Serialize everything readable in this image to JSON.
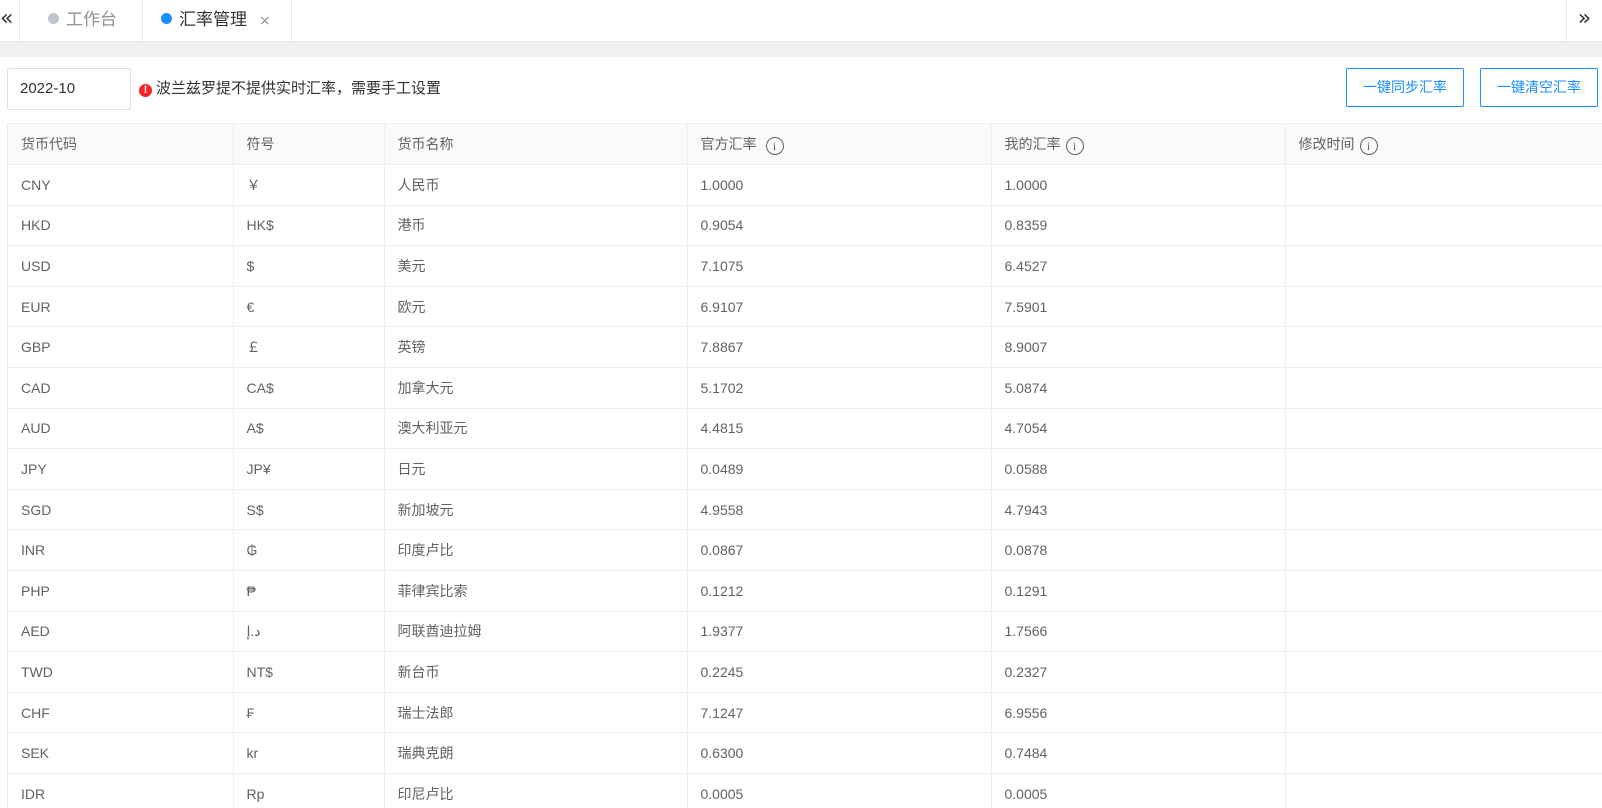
{
  "tabs": {
    "collapse_left_icon": "«",
    "expand_right_icon": "»",
    "items": [
      {
        "label": "工作台",
        "active": false
      },
      {
        "label": "汇率管理",
        "active": true,
        "close": "×"
      }
    ]
  },
  "toolbar": {
    "month": "2022-10",
    "notice_icon": "!",
    "notice": "波兰兹罗提不提供实时汇率，需要手工设置",
    "sync_button": "一键同步汇率",
    "clear_button": "一键清空汇率"
  },
  "colors": {
    "accent": "#1890ff",
    "warning": "#f5222d",
    "inactive_dot": "#c0c4cc"
  },
  "table": {
    "columns": [
      "货币代码",
      "符号",
      "货币名称",
      "官方汇率",
      "我的汇率",
      "修改时间"
    ],
    "info_icon": "i",
    "rows": [
      {
        "code": "CNY",
        "symbol": "￥",
        "name": "人民币",
        "official": "1.0000",
        "mine": "1.0000",
        "modified": ""
      },
      {
        "code": "HKD",
        "symbol": "HK$",
        "name": "港币",
        "official": "0.9054",
        "mine": "0.8359",
        "modified": ""
      },
      {
        "code": "USD",
        "symbol": "$",
        "name": "美元",
        "official": "7.1075",
        "mine": "6.4527",
        "modified": ""
      },
      {
        "code": "EUR",
        "symbol": "€",
        "name": "欧元",
        "official": "6.9107",
        "mine": "7.5901",
        "modified": ""
      },
      {
        "code": "GBP",
        "symbol": "￡",
        "name": "英镑",
        "official": "7.8867",
        "mine": "8.9007",
        "modified": ""
      },
      {
        "code": "CAD",
        "symbol": "CA$",
        "name": "加拿大元",
        "official": "5.1702",
        "mine": "5.0874",
        "modified": ""
      },
      {
        "code": "AUD",
        "symbol": "A$",
        "name": "澳大利亚元",
        "official": "4.4815",
        "mine": "4.7054",
        "modified": ""
      },
      {
        "code": "JPY",
        "symbol": "JP¥",
        "name": "日元",
        "official": "0.0489",
        "mine": "0.0588",
        "modified": ""
      },
      {
        "code": "SGD",
        "symbol": "S$",
        "name": "新加坡元",
        "official": "4.9558",
        "mine": "4.7943",
        "modified": ""
      },
      {
        "code": "INR",
        "symbol": "₲",
        "name": "印度卢比",
        "official": "0.0867",
        "mine": "0.0878",
        "modified": ""
      },
      {
        "code": "PHP",
        "symbol": "₱",
        "name": "菲律宾比索",
        "official": "0.1212",
        "mine": "0.1291",
        "modified": ""
      },
      {
        "code": "AED",
        "symbol": "د.إ",
        "name": "阿联酋迪拉姆",
        "official": "1.9377",
        "mine": "1.7566",
        "modified": ""
      },
      {
        "code": "TWD",
        "symbol": "NT$",
        "name": "新台币",
        "official": "0.2245",
        "mine": "0.2327",
        "modified": ""
      },
      {
        "code": "CHF",
        "symbol": "₣",
        "name": "瑞士法郎",
        "official": "7.1247",
        "mine": "6.9556",
        "modified": ""
      },
      {
        "code": "SEK",
        "symbol": "kr",
        "name": "瑞典克朗",
        "official": "0.6300",
        "mine": "0.7484",
        "modified": ""
      },
      {
        "code": "IDR",
        "symbol": "Rp",
        "name": "印尼卢比",
        "official": "0.0005",
        "mine": "0.0005",
        "modified": ""
      }
    ]
  }
}
